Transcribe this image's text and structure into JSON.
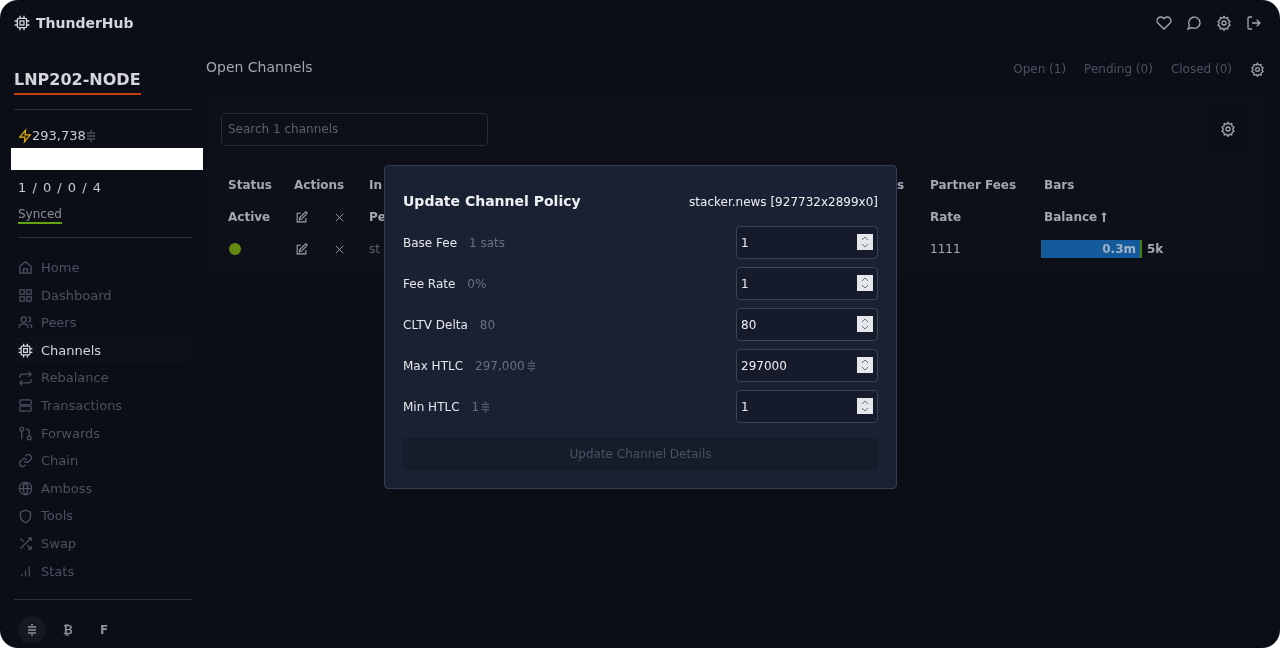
{
  "brand": "ThunderHub",
  "sidebar": {
    "node_name": "LNP202-NODE",
    "balance": "293,738",
    "channel_counts": "1 / 0 / 0 / 4",
    "sync": "Synced",
    "nav": [
      {
        "label": "Home",
        "selected": false
      },
      {
        "label": "Dashboard",
        "selected": false
      },
      {
        "label": "Peers",
        "selected": false
      },
      {
        "label": "Channels",
        "selected": true
      },
      {
        "label": "Rebalance",
        "selected": false
      },
      {
        "label": "Transactions",
        "selected": false
      },
      {
        "label": "Forwards",
        "selected": false
      },
      {
        "label": "Chain",
        "selected": false
      },
      {
        "label": "Amboss",
        "selected": false
      },
      {
        "label": "Tools",
        "selected": false
      },
      {
        "label": "Swap",
        "selected": false
      },
      {
        "label": "Stats",
        "selected": false
      }
    ],
    "currencies": [
      {
        "kind": "sats",
        "selected": true
      },
      {
        "kind": "text",
        "label": "₿",
        "selected": false
      },
      {
        "kind": "text",
        "label": "F",
        "selected": false
      }
    ]
  },
  "page": {
    "title": "Open Channels",
    "tabs": [
      "Open (1)",
      "Pending (0)",
      "Closed (0)"
    ],
    "search": {
      "placeholder": "Search 1 channels"
    }
  },
  "table": {
    "header": [
      "Status",
      "Actions",
      "In",
      "s",
      "Partner Fees",
      "Bars"
    ],
    "subheader": {
      "status": "Active",
      "info": "Pe",
      "partner": "Rate",
      "bars": "Balance"
    },
    "rows": [
      {
        "active": true,
        "info": "st",
        "partner_rate": "1111",
        "balance": {
          "level": 0.98,
          "local": "0.3m",
          "remote": "5k"
        }
      }
    ]
  },
  "modal": {
    "title": "Update Channel Policy",
    "channel": "stacker.news [927732x2899x0]",
    "fields": [
      {
        "label": "Base Fee",
        "current": "1 sats",
        "sats_symbol": false,
        "value": "1"
      },
      {
        "label": "Fee Rate",
        "current": "0%",
        "sats_symbol": false,
        "value": "1"
      },
      {
        "label": "CLTV Delta",
        "current": "80",
        "sats_symbol": false,
        "value": "80"
      },
      {
        "label": "Max HTLC",
        "current": "297,000",
        "sats_symbol": true,
        "value": "297000"
      },
      {
        "label": "Min HTLC",
        "current": "1",
        "sats_symbol": true,
        "value": "1"
      }
    ],
    "button": {
      "label": "Update Channel Details",
      "disabled": true
    }
  }
}
